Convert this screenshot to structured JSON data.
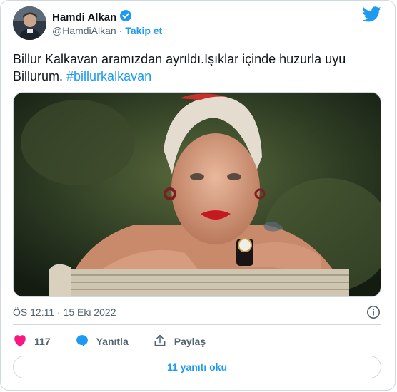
{
  "author": {
    "name": "Hamdi Alkan",
    "handle": "@HamdiAlkan",
    "separator": "·",
    "follow_label": "Takip et"
  },
  "tweet": {
    "text": "Billur Kalkavan aramızdan ayrıldı.Işıklar içinde huzurla uyu Billurum.",
    "hashtag": "#billurkalkavan"
  },
  "meta": {
    "timestamp": "ÖS 12:11 · 15 Eki 2022"
  },
  "actions": {
    "like_count": "117",
    "reply_label": "Yanıtla",
    "share_label": "Paylaş",
    "read_replies_label": "11 yanıtı oku"
  },
  "colors": {
    "accent": "#1d9bf0",
    "like": "#f91880",
    "border": "#cfd9de",
    "secondary_text": "#536471"
  },
  "icons": [
    "verified-badge-icon",
    "twitter-bird-icon",
    "info-icon",
    "heart-icon",
    "reply-bubble-icon",
    "share-icon"
  ]
}
